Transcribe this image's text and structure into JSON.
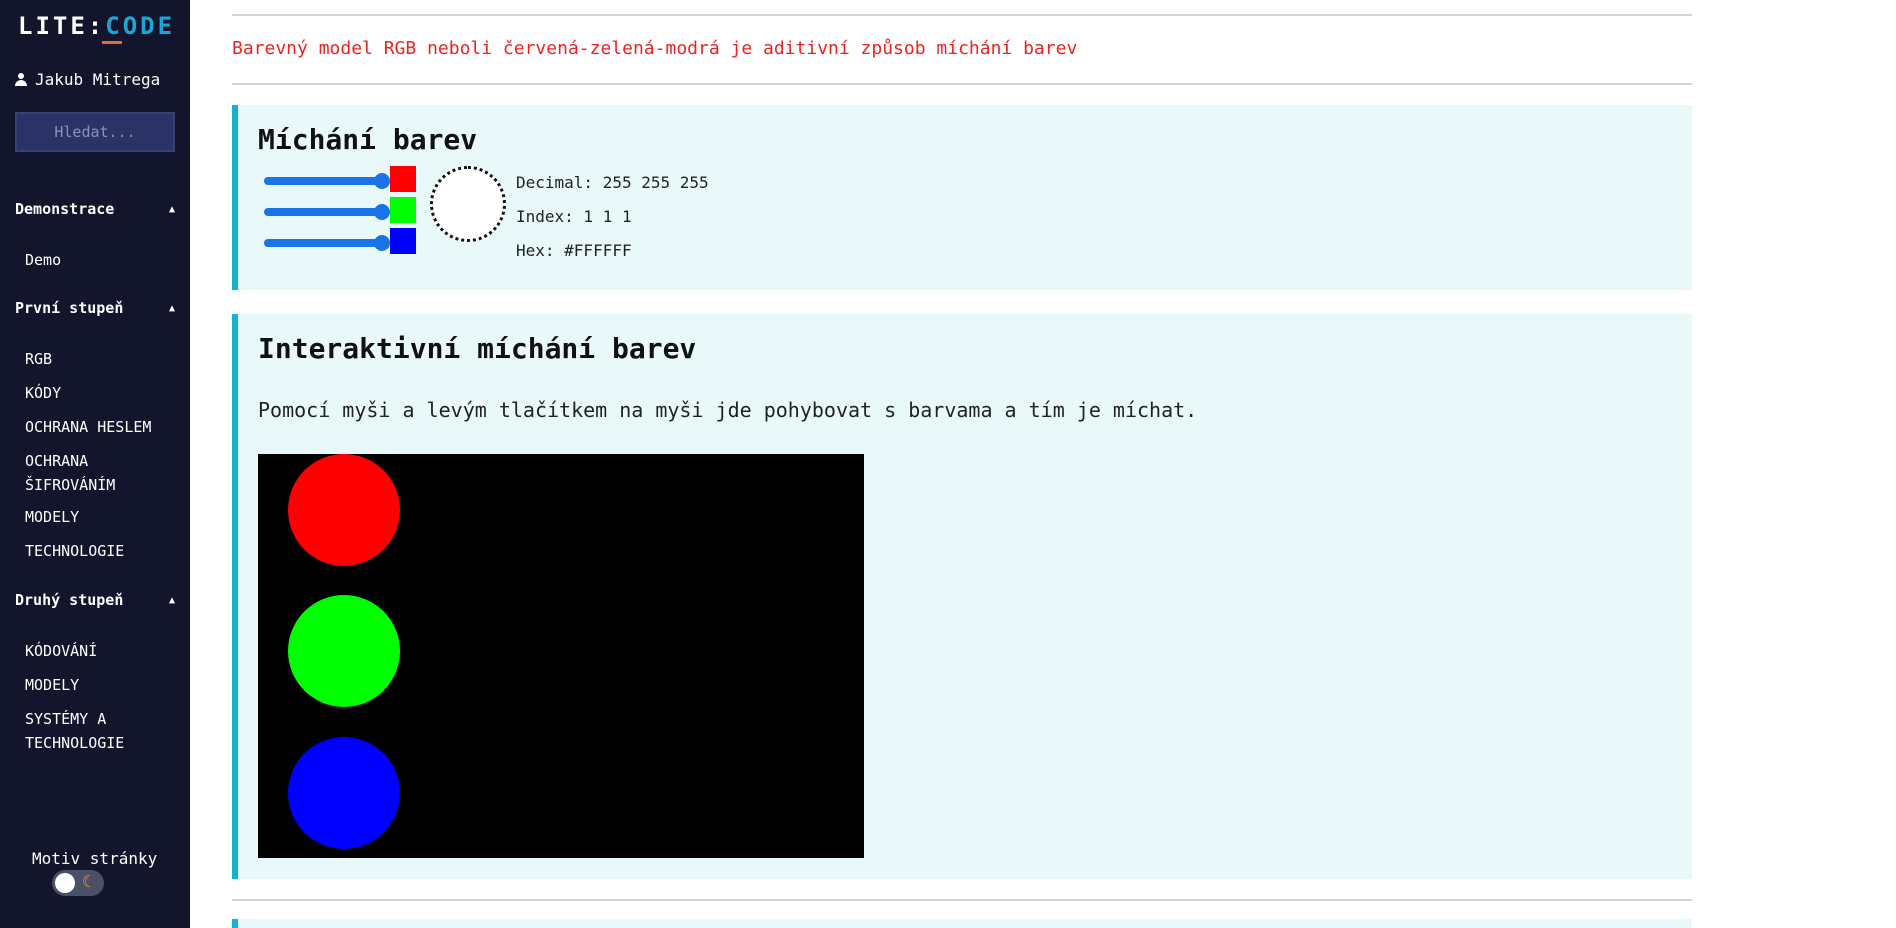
{
  "sidebar": {
    "logo_left": "LITE:",
    "logo_right": "CODE",
    "user_name": "Jakub Mitrega",
    "search_placeholder": "Hledat...",
    "sections": [
      {
        "title": "Demonstrace",
        "items": [
          "Demo"
        ]
      },
      {
        "title": "První stupeň",
        "items": [
          "RGB",
          "KÓDY",
          "OCHRANA HESLEM",
          "OCHRANA ŠIFROVÁNÍM",
          "MODELY",
          "TECHNOLOGIE"
        ]
      },
      {
        "title": "Druhý stupeň",
        "items": [
          "KÓDOVÁNÍ",
          "MODELY",
          "SYSTÉMY A TECHNOLOGIE"
        ]
      }
    ],
    "theme_label": "Motiv stránky",
    "caret": "▲",
    "moon": "☾"
  },
  "intro_text": "Barevný model RGB neboli červená-zelená-modrá je aditivní způsob míchání barev",
  "mixer": {
    "title": "Míchání barev",
    "sliders": [
      {
        "channel": "red",
        "value": 255,
        "color": "#ff0000"
      },
      {
        "channel": "green",
        "value": 255,
        "color": "#00ff00"
      },
      {
        "channel": "blue",
        "value": 255,
        "color": "#0000ff"
      }
    ],
    "decimal": "Decimal: 255 255 255",
    "index": "Index: 1 1 1",
    "hex": "Hex: #FFFFFF"
  },
  "interactive": {
    "title": "Interaktivní míchání barev",
    "description": "Pomocí myši a levým tlačítkem na myši jde pohybovat s barvama a tím je míchat.",
    "circles": [
      "#ff0000",
      "#00ff00",
      "#0000ff"
    ]
  },
  "colors": {
    "sidebar_bg": "#12152b",
    "accent": "#17b3c8",
    "intro": "#ee2222",
    "card_bg": "#e9f9fa"
  }
}
